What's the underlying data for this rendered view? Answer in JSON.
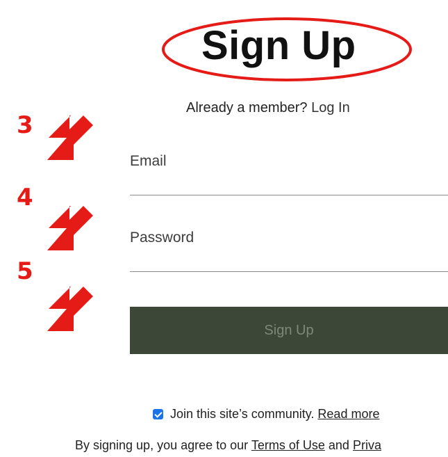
{
  "header": {
    "title": "Sign Up",
    "already_member_prompt": "Already a member?",
    "login_link": "Log In"
  },
  "annotations": {
    "steps": [
      "3",
      "4",
      "5"
    ],
    "accent_color": "#e41b17"
  },
  "form": {
    "email_label": "Email",
    "password_label": "Password",
    "submit_label": "Sign Up",
    "button_color": "#3d4737"
  },
  "community": {
    "checked": true,
    "text": "Join this site’s community.",
    "read_more": "Read more"
  },
  "legal": {
    "prefix": "By signing up, you agree to our",
    "terms_link": "Terms of Use",
    "and": "and",
    "privacy_link_visible": "Priva"
  }
}
